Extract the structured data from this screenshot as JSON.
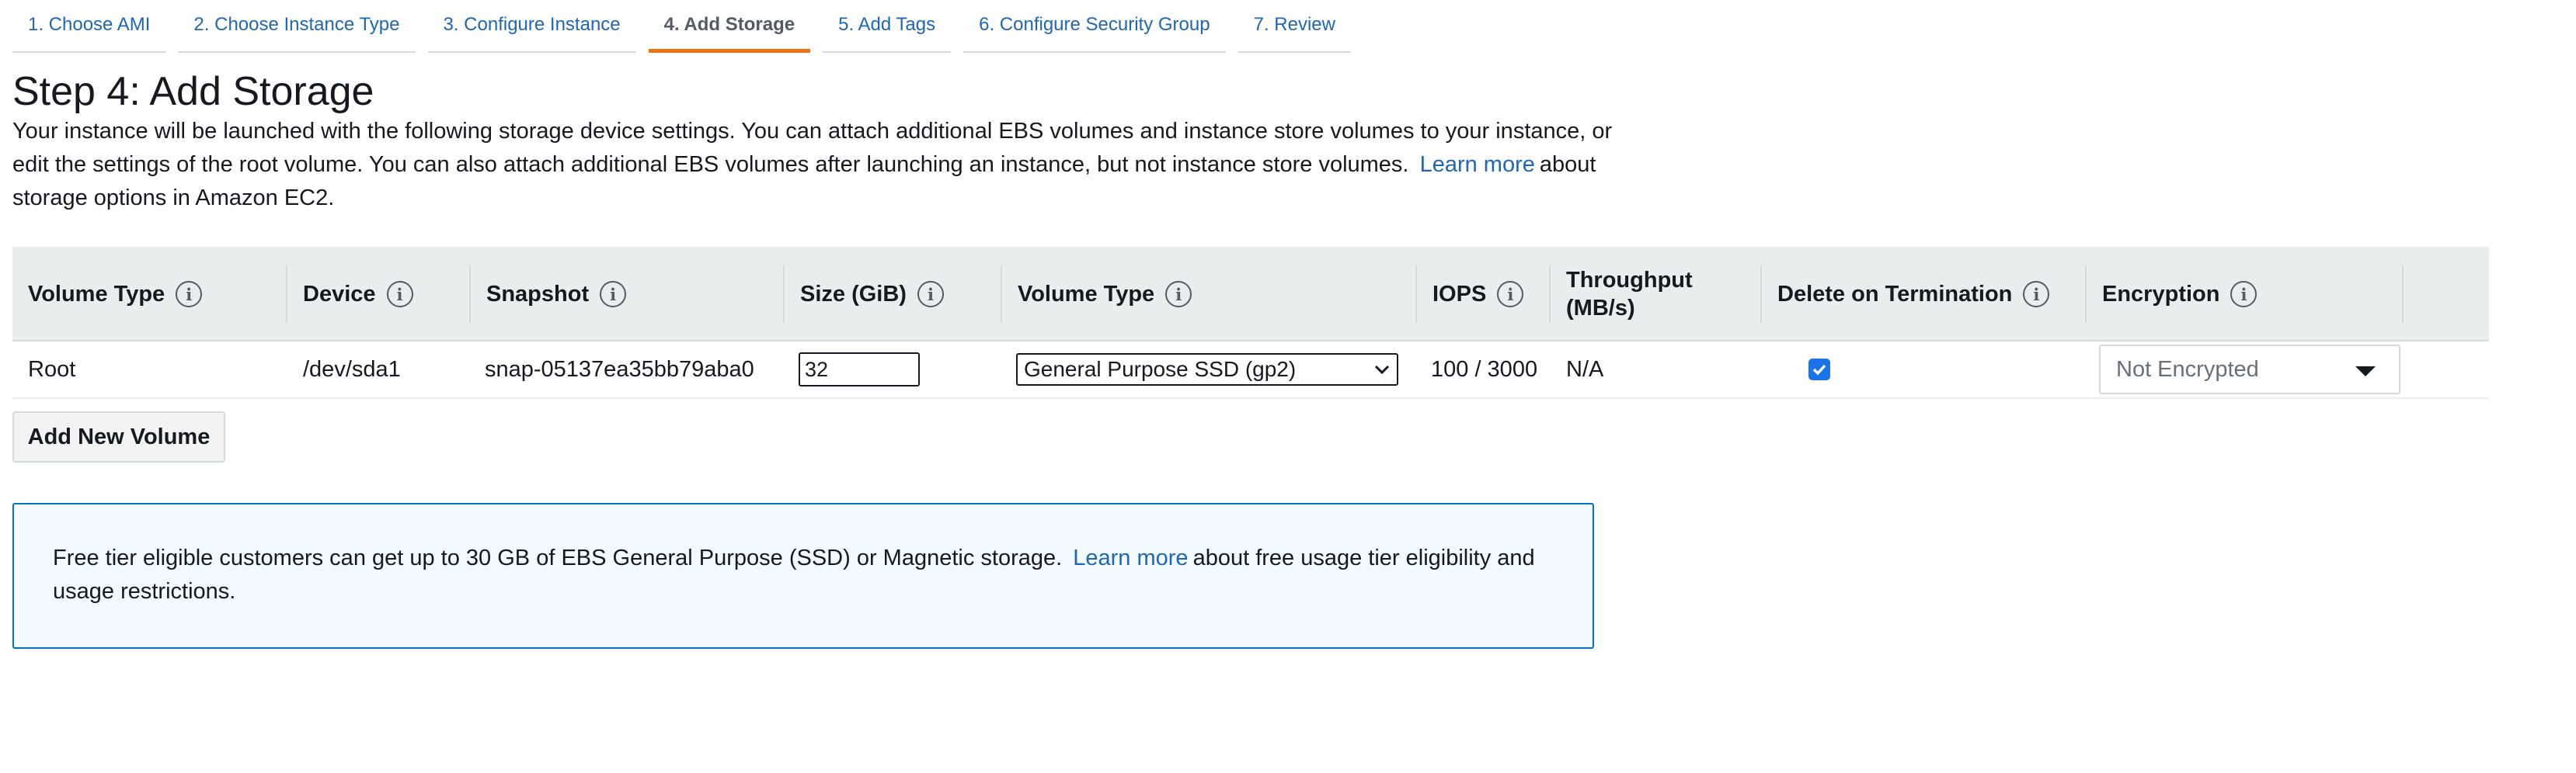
{
  "tabs": [
    {
      "label": "1. Choose AMI"
    },
    {
      "label": "2. Choose Instance Type"
    },
    {
      "label": "3. Configure Instance"
    },
    {
      "label": "4. Add Storage",
      "active": true
    },
    {
      "label": "5. Add Tags"
    },
    {
      "label": "6. Configure Security Group"
    },
    {
      "label": "7. Review"
    }
  ],
  "page": {
    "title": "Step 4: Add Storage",
    "intro_text": "Your instance will be launched with the following storage device settings. You can attach additional EBS volumes and instance store volumes to your instance, or edit the settings of the root volume. You can also attach additional EBS volumes after launching an instance, but not instance store volumes.",
    "intro_link": "Learn more",
    "intro_suffix": "about storage options in Amazon EC2."
  },
  "table": {
    "headers": {
      "volume_type": "Volume Type",
      "device": "Device",
      "snapshot": "Snapshot",
      "size": "Size (GiB)",
      "vol_type": "Volume Type",
      "iops": "IOPS",
      "throughput": "Throughput (MB/s)",
      "delete_on_termination": "Delete on Termination",
      "encryption": "Encryption"
    },
    "rows": [
      {
        "volume_type": "Root",
        "device": "/dev/sda1",
        "snapshot": "snap-05137ea35bb79aba0",
        "size": "32",
        "vol_type": "General Purpose SSD (gp2)",
        "iops": "100 / 3000",
        "throughput": "N/A",
        "delete_on_termination": true,
        "encryption": "Not Encrypted"
      }
    ]
  },
  "add_volume_button": "Add New Volume",
  "alert": {
    "text": "Free tier eligible customers can get up to 30 GB of EBS General Purpose (SSD) or Magnetic storage.",
    "link": "Learn more",
    "suffix": "about free usage tier eligibility and usage restrictions."
  },
  "icons": {
    "info": "info-icon",
    "select_chevron": "chevron-down-icon",
    "checkbox": "check-icon",
    "dropdown_caret": "caret-down-icon"
  },
  "colors": {
    "link": "#1f66b3",
    "active_tab_underline": "#ec7211",
    "table_header_bg": "#eaeded",
    "alert_bg": "#f1faff",
    "alert_border": "#0073bb",
    "checkbox": "#1a73e8"
  }
}
